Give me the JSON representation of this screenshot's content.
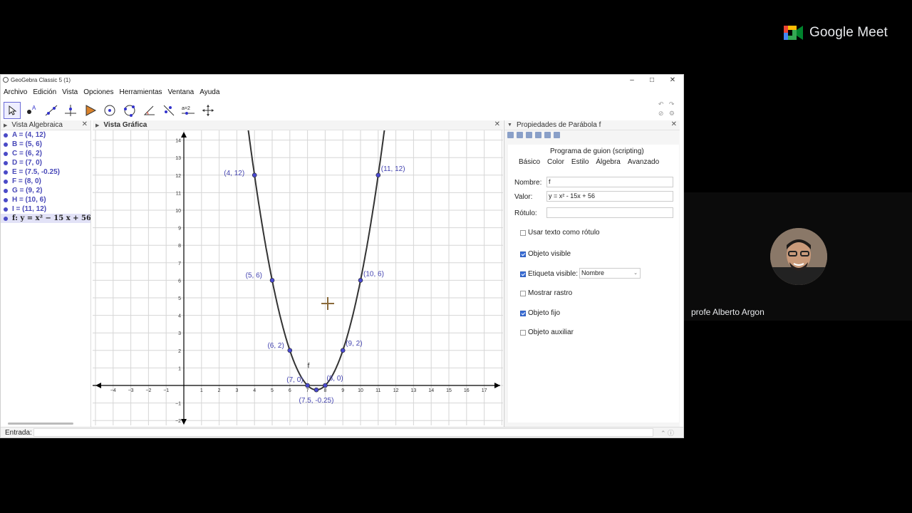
{
  "meet": {
    "brand": "Google Meet",
    "participant_name": "profe Alberto Argon"
  },
  "window": {
    "title": "GeoGebra Classic 5 (1)",
    "controls": [
      "–",
      "□",
      "✕"
    ]
  },
  "menu": [
    "Archivo",
    "Edición",
    "Vista",
    "Opciones",
    "Herramientas",
    "Ventana",
    "Ayuda"
  ],
  "toolbar": {
    "tools": [
      "move-tool-icon",
      "point-tool-icon",
      "line-tool-icon",
      "perpendicular-tool-icon",
      "polygon-tool-icon",
      "circle-tool-icon",
      "circle-three-points-icon",
      "angle-tool-icon",
      "reflect-tool-icon",
      "slider-tool-icon",
      "move-view-icon"
    ],
    "slider_label": "a=2"
  },
  "algebra": {
    "title": "Vista Algebraica",
    "items": [
      "A = (4, 12)",
      "B = (5, 6)",
      "C = (6, 2)",
      "D = (7, 0)",
      "E = (7.5, -0.25)",
      "F = (8, 0)",
      "G = (9, 2)",
      "H = (10, 6)",
      "I = (11, 12)"
    ],
    "function_label": "f: y = x² − 15 x + 56"
  },
  "graphics": {
    "title": "Vista Gráfica",
    "function_name": "f"
  },
  "properties": {
    "title": "Propiedades de Parábola f",
    "scripting_tab": "Programa de guion (scripting)",
    "tabs": [
      "Básico",
      "Color",
      "Estilo",
      "Álgebra",
      "Avanzado"
    ],
    "name_label": "Nombre:",
    "name_value": "f",
    "value_label": "Valor:",
    "value_value": "y = x² - 15x + 56",
    "caption_label": "Rótulo:",
    "caption_value": "",
    "use_text_caption": "Usar texto como rótulo",
    "object_visible": "Objeto visible",
    "label_visible": "Etiqueta visible:",
    "label_option": "Nombre",
    "show_trace": "Mostrar rastro",
    "fixed_object": "Objeto fijo",
    "auxiliary_object": "Objeto auxiliar"
  },
  "input": {
    "label": "Entrada:"
  },
  "chart_data": {
    "type": "line",
    "function": "y = x^2 - 15x + 56",
    "xlim": [
      -5,
      18
    ],
    "ylim": [
      -2,
      14
    ],
    "x_ticks": [
      -4,
      -3,
      -2,
      -1,
      1,
      2,
      3,
      4,
      5,
      6,
      7,
      8,
      9,
      10,
      11,
      12,
      13,
      14,
      15,
      16,
      17
    ],
    "y_ticks": [
      -2,
      -1,
      1,
      2,
      3,
      4,
      5,
      6,
      7,
      8,
      9,
      10,
      11,
      12,
      13,
      14
    ],
    "grid": true,
    "points": [
      {
        "x": 4,
        "y": 12,
        "label": "(4, 12)"
      },
      {
        "x": 5,
        "y": 6,
        "label": "(5, 6)"
      },
      {
        "x": 6,
        "y": 2,
        "label": "(6, 2)"
      },
      {
        "x": 7,
        "y": 0,
        "label": "(7, 0)"
      },
      {
        "x": 7.5,
        "y": -0.25,
        "label": "(7.5, -0.25)"
      },
      {
        "x": 8,
        "y": 0,
        "label": "(8, 0)"
      },
      {
        "x": 9,
        "y": 2,
        "label": "(9, 2)"
      },
      {
        "x": 10,
        "y": 6,
        "label": "(10, 6)"
      },
      {
        "x": 11,
        "y": 12,
        "label": "(11, 12)"
      }
    ],
    "point_color": "#4a4ad0",
    "curve_color": "#333333",
    "axis_color": "#000000"
  }
}
